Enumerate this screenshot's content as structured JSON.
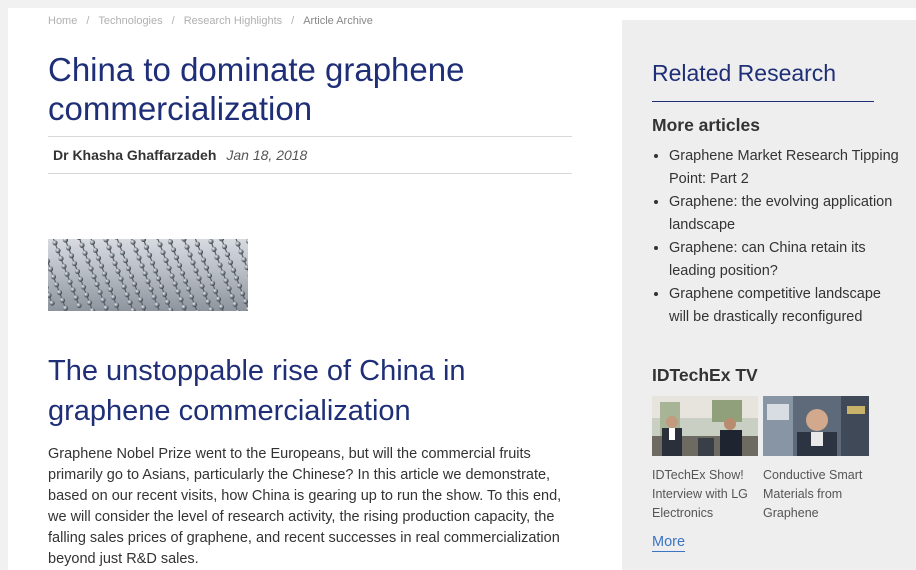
{
  "breadcrumb": {
    "items": [
      "Home",
      "Technologies",
      "Research Highlights",
      "Article Archive"
    ],
    "separator": "/"
  },
  "article": {
    "title": "China to dominate graphene commercialization",
    "author": "Dr Khasha Ghaffarzadeh",
    "date": "Jan 18, 2018",
    "section_title": "The unstoppable rise of China in graphene commercialization",
    "lead": "Graphene Nobel Prize went to the Europeans, but will the commercial fruits primarily go to Asians, particularly the Chinese? In this article we demonstrate, based on our recent visits, how China is gearing up to run the show. To this end, we will consider the level of research activity, the rising production capacity, the falling sales prices of graphene, and recent successes in real commercialization beyond just R&D sales."
  },
  "sidebar": {
    "related_title": "Related Research",
    "more_articles_title": "More articles",
    "articles": [
      "Graphene Market Research Tipping Point: Part 2",
      "Graphene: the evolving application landscape",
      "Graphene: can China retain its leading position?",
      "Graphene competitive landscape will be drastically reconfigured"
    ],
    "tv_title": "IDTechEx TV",
    "tv_items": [
      "IDTechEx Show! Interview with LG Electronics",
      "Conductive Smart Materials from Graphene"
    ],
    "more_label": "More"
  },
  "colors": {
    "heading_blue": "#1f2f77",
    "link_blue": "#3a74c4",
    "sidebar_bg": "#eeeeee"
  }
}
